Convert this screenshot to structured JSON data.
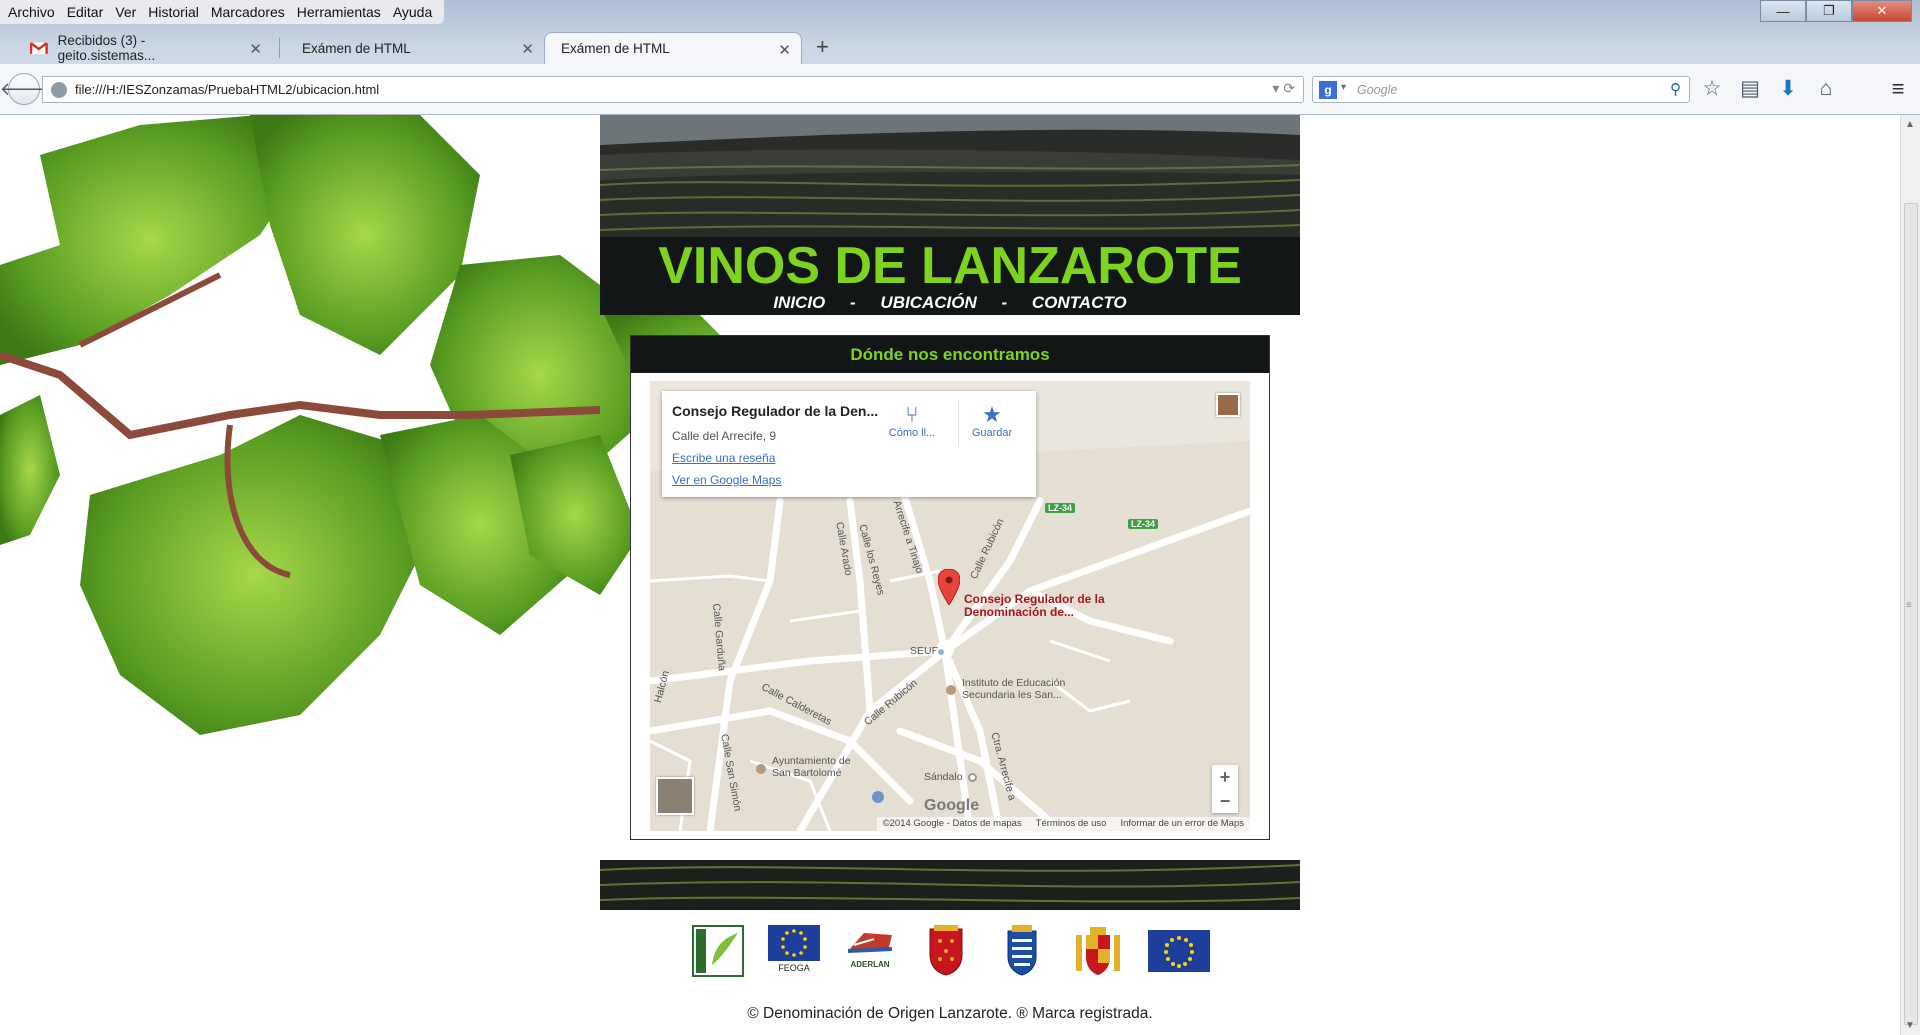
{
  "browser": {
    "menu": [
      "Archivo",
      "Editar",
      "Ver",
      "Historial",
      "Marcadores",
      "Herramientas",
      "Ayuda"
    ],
    "tabs": [
      {
        "label": "Recibidos (3) - geito.sistemas...",
        "active": false
      },
      {
        "label": "Exámen de HTML",
        "active": false
      },
      {
        "label": "Exámen de HTML",
        "active": true
      }
    ],
    "new_tab": "+",
    "url": "file:///H:/IESZonzamas/PruebaHTML2/ubicacion.html",
    "search_placeholder": "Google",
    "search_engine_letter": "g",
    "window_controls": {
      "minimize": "—",
      "restore": "❐",
      "close": "✕"
    },
    "icons": [
      "back-icon",
      "globe-icon",
      "reload-icon",
      "search-icon",
      "bookmark-star-icon",
      "bookmarks-list-icon",
      "download-icon",
      "home-icon",
      "menu-icon"
    ]
  },
  "site": {
    "title": "VINOS DE LANZAROTE",
    "nav": [
      {
        "label": "INICIO"
      },
      {
        "label": "UBICACIÓN"
      },
      {
        "label": "CONTACTO"
      }
    ],
    "nav_separator": "-",
    "section_title": "Dónde nos encontramos",
    "map": {
      "place_name": "Consejo Regulador de la Den...",
      "address": "Calle del Arrecife, 9",
      "review_link": "Escribe una reseña",
      "google_maps_link": "Ver en Google Maps",
      "directions_label": "Cómo ll...",
      "save_label": "Guardar",
      "marker_label_1": "Consejo Regulador de la",
      "marker_label_2": "Denominación de...",
      "labels": {
        "seur": "SEUR",
        "instituto_1": "Instituto de Educación",
        "instituto_2": "Secundaria les San...",
        "ayto_1": "Ayuntamiento de",
        "ayto_2": "San Bartolomé",
        "sandalo": "Sándalo",
        "calle_rubicon_1": "Calle Rubicón",
        "calle_rubicon_2": "Calle Rubicón",
        "calle_calderetas": "Calle Calderetas",
        "calle_arado": "Calle Arado",
        "calle_los_reyes": "Calle los Reyes",
        "calle_gardunia": "Calle Garduña",
        "calle_san_simon": "Calle San Simón",
        "arrecife_tinajo": "Arrecife a Tinajo",
        "ctra_arrecife": "Ctra. Arrecife a",
        "halcon": "Halcón",
        "lz34_a": "LZ-34",
        "lz34_b": "LZ-34"
      },
      "zoom_in": "+",
      "zoom_out": "−",
      "google_logo": "Google",
      "footer": [
        "©2014 Google - Datos de mapas",
        "Términos de uso",
        "Informar de un error de Maps"
      ]
    },
    "footer_logos": [
      {
        "name": "leader-logo",
        "caption": ""
      },
      {
        "name": "feoga-logo",
        "caption": "FEOGA"
      },
      {
        "name": "aderlan-logo",
        "caption": "ADERLAN"
      },
      {
        "name": "lanzarote-shield-logo",
        "caption": ""
      },
      {
        "name": "canarias-shield-logo",
        "caption": ""
      },
      {
        "name": "spain-shield-logo",
        "caption": ""
      },
      {
        "name": "eu-flag-logo",
        "caption": ""
      }
    ],
    "copyright": "© Denominación de Origen Lanzarote. ® Marca registrada."
  },
  "colors": {
    "brand_green": "#7ed321",
    "header_bg": "#121617",
    "link_blue": "#3a6fc4",
    "marker_red": "#e8443a"
  }
}
